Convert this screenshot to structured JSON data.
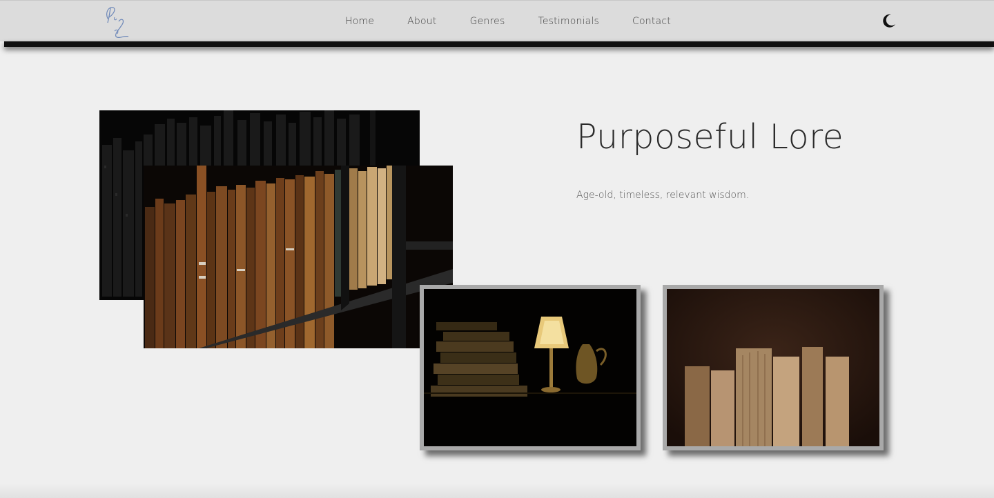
{
  "header": {
    "logo_alt": "PL monogram",
    "nav": [
      {
        "label": "Home"
      },
      {
        "label": "About"
      },
      {
        "label": "Genres"
      },
      {
        "label": "Testimonials"
      },
      {
        "label": "Contact"
      }
    ],
    "theme_icon": "moon-icon"
  },
  "hero": {
    "title": "Purposeful Lore",
    "subtitle": "Age-old, timeless, relevant wisdom."
  },
  "images": [
    {
      "name": "dark-bookshelf-photo"
    },
    {
      "name": "old-books-shelf-photo"
    },
    {
      "name": "lamp-and-books-photo"
    },
    {
      "name": "worn-books-photo"
    }
  ],
  "colors": {
    "background": "#efefef",
    "navbar": "#dcdcdc",
    "logo": "#6b86b8",
    "frame": "#a9a9a9",
    "text": "#2b2b2b"
  }
}
